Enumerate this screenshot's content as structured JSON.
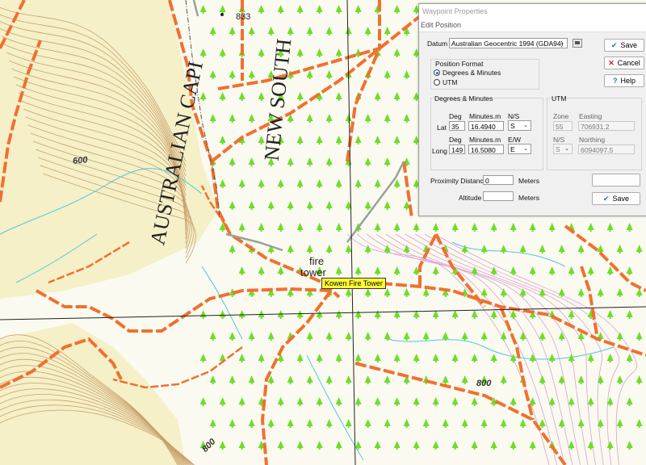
{
  "map": {
    "spot_height": "833",
    "contours": [
      "600",
      "800",
      "800"
    ],
    "region_label_1": "AUSTRALIAN CAPI",
    "region_label_2": "NEW SOUTH",
    "fire_label_line1": "fire",
    "fire_label_line2": "tower",
    "tooltip": "Kowen Fire Tower",
    "colors": {
      "road": "#f07030",
      "contour": "#c9a06a",
      "river": "#4fc8e0",
      "tree": "#6edd2a",
      "grid": "#222222"
    }
  },
  "dialog": {
    "title": "Waypoint Properties",
    "menu": "Edit Position",
    "datum_label": "Datum",
    "datum_value": "Australian Geocentric 1994 (GDA94)",
    "save_label": "Save",
    "cancel_label": "Cancel",
    "help_label": "Help",
    "position_format": {
      "title": "Position  Format",
      "opt_dm": "Degrees & Minutes",
      "opt_utm": "UTM",
      "selected": "Degrees & Minutes"
    },
    "dm": {
      "title": "Degrees & Minutes",
      "deg_header": "Deg",
      "min_header": "Minutes.m",
      "ns_header": "N/S",
      "ew_header": "E/W",
      "lat_label": "Lat",
      "lat_deg": "35",
      "lat_min": "16.4940",
      "lat_ns": "S",
      "long_label": "Long",
      "long_deg": "149",
      "long_min": "16.5080",
      "long_ew": "E"
    },
    "utm": {
      "title": "UTM",
      "zone_header": "Zone",
      "easting_header": "Easting",
      "zone": "55",
      "easting": "706931.2",
      "ns_header": "N/S",
      "northing_header": "Northing",
      "ns": "S",
      "northing": "6094097.5"
    },
    "proximity_label": "Proximity Distance",
    "proximity_value": "0",
    "proximity_unit": "Meters",
    "altitude_label": "Altitude",
    "altitude_value": "",
    "altitude_unit": "Meters",
    "save2_label": "Save"
  }
}
